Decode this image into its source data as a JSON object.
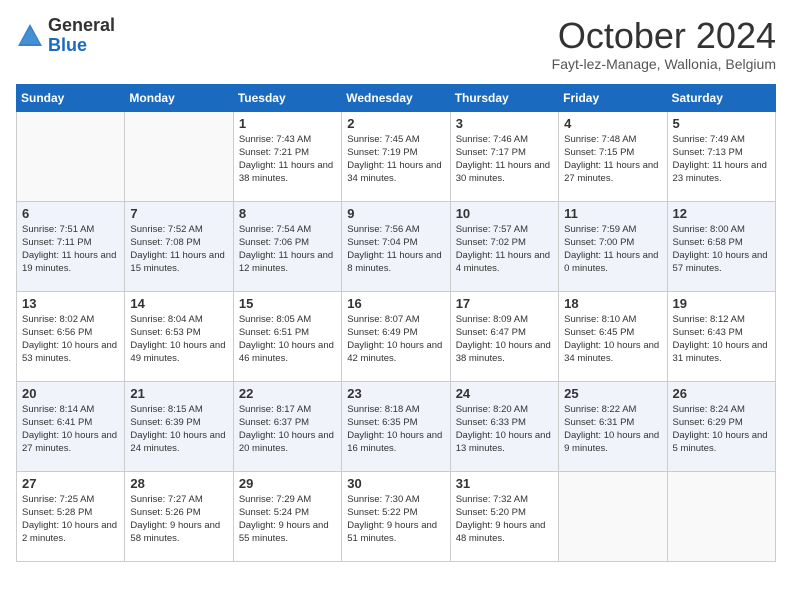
{
  "header": {
    "logo_general": "General",
    "logo_blue": "Blue",
    "month_title": "October 2024",
    "subtitle": "Fayt-lez-Manage, Wallonia, Belgium"
  },
  "days_of_week": [
    "Sunday",
    "Monday",
    "Tuesday",
    "Wednesday",
    "Thursday",
    "Friday",
    "Saturday"
  ],
  "weeks": [
    [
      {
        "day": "",
        "detail": ""
      },
      {
        "day": "",
        "detail": ""
      },
      {
        "day": "1",
        "detail": "Sunrise: 7:43 AM\nSunset: 7:21 PM\nDaylight: 11 hours\nand 38 minutes."
      },
      {
        "day": "2",
        "detail": "Sunrise: 7:45 AM\nSunset: 7:19 PM\nDaylight: 11 hours\nand 34 minutes."
      },
      {
        "day": "3",
        "detail": "Sunrise: 7:46 AM\nSunset: 7:17 PM\nDaylight: 11 hours\nand 30 minutes."
      },
      {
        "day": "4",
        "detail": "Sunrise: 7:48 AM\nSunset: 7:15 PM\nDaylight: 11 hours\nand 27 minutes."
      },
      {
        "day": "5",
        "detail": "Sunrise: 7:49 AM\nSunset: 7:13 PM\nDaylight: 11 hours\nand 23 minutes."
      }
    ],
    [
      {
        "day": "6",
        "detail": "Sunrise: 7:51 AM\nSunset: 7:11 PM\nDaylight: 11 hours\nand 19 minutes."
      },
      {
        "day": "7",
        "detail": "Sunrise: 7:52 AM\nSunset: 7:08 PM\nDaylight: 11 hours\nand 15 minutes."
      },
      {
        "day": "8",
        "detail": "Sunrise: 7:54 AM\nSunset: 7:06 PM\nDaylight: 11 hours\nand 12 minutes."
      },
      {
        "day": "9",
        "detail": "Sunrise: 7:56 AM\nSunset: 7:04 PM\nDaylight: 11 hours\nand 8 minutes."
      },
      {
        "day": "10",
        "detail": "Sunrise: 7:57 AM\nSunset: 7:02 PM\nDaylight: 11 hours\nand 4 minutes."
      },
      {
        "day": "11",
        "detail": "Sunrise: 7:59 AM\nSunset: 7:00 PM\nDaylight: 11 hours\nand 0 minutes."
      },
      {
        "day": "12",
        "detail": "Sunrise: 8:00 AM\nSunset: 6:58 PM\nDaylight: 10 hours\nand 57 minutes."
      }
    ],
    [
      {
        "day": "13",
        "detail": "Sunrise: 8:02 AM\nSunset: 6:56 PM\nDaylight: 10 hours\nand 53 minutes."
      },
      {
        "day": "14",
        "detail": "Sunrise: 8:04 AM\nSunset: 6:53 PM\nDaylight: 10 hours\nand 49 minutes."
      },
      {
        "day": "15",
        "detail": "Sunrise: 8:05 AM\nSunset: 6:51 PM\nDaylight: 10 hours\nand 46 minutes."
      },
      {
        "day": "16",
        "detail": "Sunrise: 8:07 AM\nSunset: 6:49 PM\nDaylight: 10 hours\nand 42 minutes."
      },
      {
        "day": "17",
        "detail": "Sunrise: 8:09 AM\nSunset: 6:47 PM\nDaylight: 10 hours\nand 38 minutes."
      },
      {
        "day": "18",
        "detail": "Sunrise: 8:10 AM\nSunset: 6:45 PM\nDaylight: 10 hours\nand 34 minutes."
      },
      {
        "day": "19",
        "detail": "Sunrise: 8:12 AM\nSunset: 6:43 PM\nDaylight: 10 hours\nand 31 minutes."
      }
    ],
    [
      {
        "day": "20",
        "detail": "Sunrise: 8:14 AM\nSunset: 6:41 PM\nDaylight: 10 hours\nand 27 minutes."
      },
      {
        "day": "21",
        "detail": "Sunrise: 8:15 AM\nSunset: 6:39 PM\nDaylight: 10 hours\nand 24 minutes."
      },
      {
        "day": "22",
        "detail": "Sunrise: 8:17 AM\nSunset: 6:37 PM\nDaylight: 10 hours\nand 20 minutes."
      },
      {
        "day": "23",
        "detail": "Sunrise: 8:18 AM\nSunset: 6:35 PM\nDaylight: 10 hours\nand 16 minutes."
      },
      {
        "day": "24",
        "detail": "Sunrise: 8:20 AM\nSunset: 6:33 PM\nDaylight: 10 hours\nand 13 minutes."
      },
      {
        "day": "25",
        "detail": "Sunrise: 8:22 AM\nSunset: 6:31 PM\nDaylight: 10 hours\nand 9 minutes."
      },
      {
        "day": "26",
        "detail": "Sunrise: 8:24 AM\nSunset: 6:29 PM\nDaylight: 10 hours\nand 5 minutes."
      }
    ],
    [
      {
        "day": "27",
        "detail": "Sunrise: 7:25 AM\nSunset: 5:28 PM\nDaylight: 10 hours\nand 2 minutes."
      },
      {
        "day": "28",
        "detail": "Sunrise: 7:27 AM\nSunset: 5:26 PM\nDaylight: 9 hours\nand 58 minutes."
      },
      {
        "day": "29",
        "detail": "Sunrise: 7:29 AM\nSunset: 5:24 PM\nDaylight: 9 hours\nand 55 minutes."
      },
      {
        "day": "30",
        "detail": "Sunrise: 7:30 AM\nSunset: 5:22 PM\nDaylight: 9 hours\nand 51 minutes."
      },
      {
        "day": "31",
        "detail": "Sunrise: 7:32 AM\nSunset: 5:20 PM\nDaylight: 9 hours\nand 48 minutes."
      },
      {
        "day": "",
        "detail": ""
      },
      {
        "day": "",
        "detail": ""
      }
    ]
  ]
}
